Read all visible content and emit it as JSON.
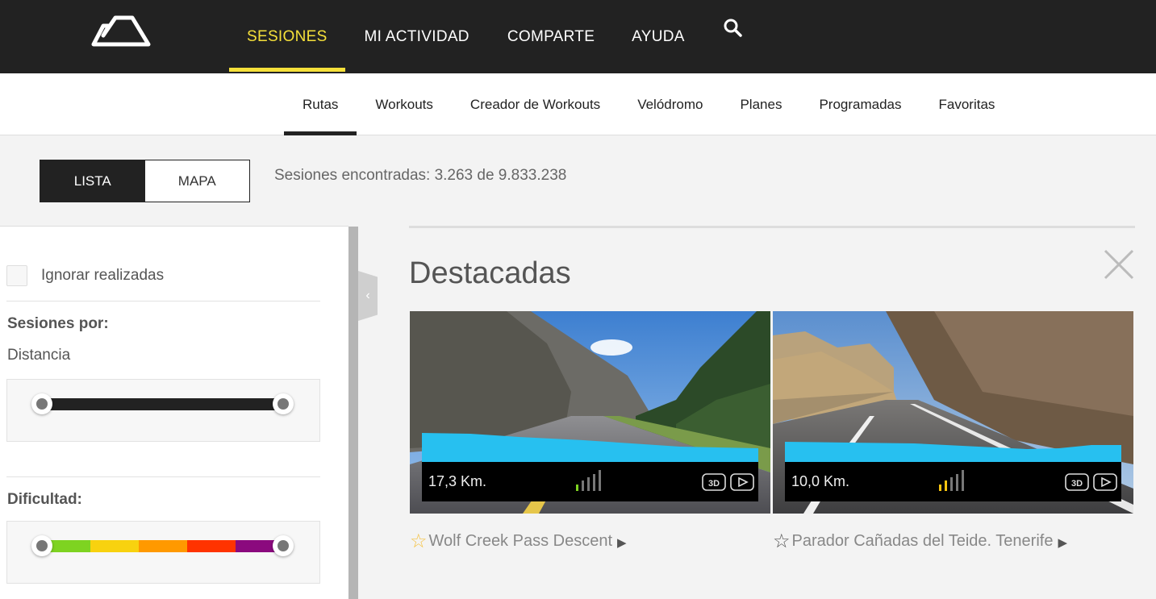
{
  "header": {
    "nav": [
      "SESIONES",
      "MI ACTIVIDAD",
      "COMPARTE",
      "AYUDA"
    ],
    "active_index": 0,
    "search_icon": "search-icon",
    "accent": "#f5e03a"
  },
  "subnav": {
    "items": [
      "Rutas",
      "Workouts",
      "Creador de Workouts",
      "Velódromo",
      "Planes",
      "Programadas",
      "Favoritas"
    ],
    "active_index": 0
  },
  "view_toggle": {
    "list": "LISTA",
    "map": "MAPA",
    "selected": "LISTA"
  },
  "sessions_found": "Sesiones encontradas: 3.263 de 9.833.238",
  "filters": {
    "ignore_done": {
      "label": "Ignorar realizadas",
      "checked": false
    },
    "sort_by_label": "Sesiones por:",
    "sort_by_value": "Distancia",
    "distance_range": [
      0,
      1
    ],
    "difficulty_label": "Dificultad:",
    "difficulty_colors": [
      "#7ed321",
      "#f8d20f",
      "#ff9900",
      "#ff3300",
      "#8b0a7e"
    ],
    "difficulty_range": [
      0,
      1
    ]
  },
  "featured": {
    "title": "Destacadas",
    "cards": [
      {
        "distance": "17,3 Km.",
        "difficulty_level": 1,
        "difficulty_color": "#7ed321",
        "title": "Wolf Creek Pass Descent",
        "favorite": true
      },
      {
        "distance": "10,0 Km.",
        "difficulty_level": 2,
        "difficulty_color": "#f8c40f",
        "title": "Parador Cañadas del Teide. Tenerife",
        "favorite": false
      }
    ]
  }
}
